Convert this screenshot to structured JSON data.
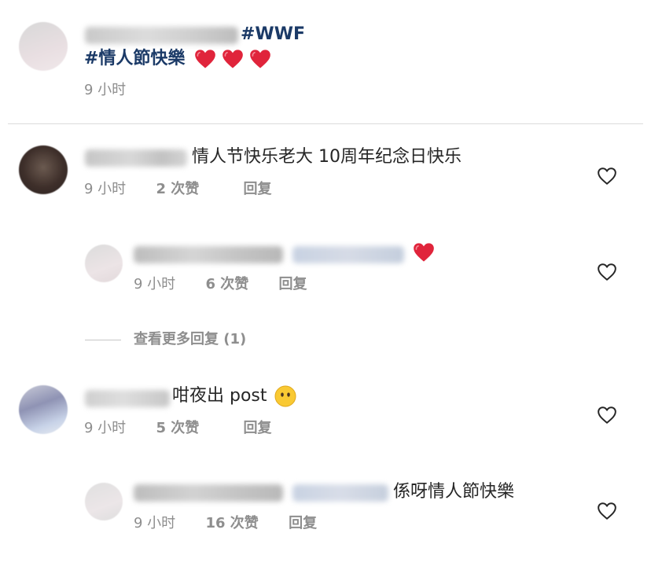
{
  "caption": {
    "hashtag_wwf": "#WWF",
    "hashtag_valentine": "#情人節快樂",
    "time": "9 小时"
  },
  "comments": [
    {
      "text": "情人节快乐老大 10周年纪念日快乐",
      "time": "9 小时",
      "likes": "2 次赞",
      "reply": "回复",
      "replies": [
        {
          "time": "9 小时",
          "likes": "6 次赞",
          "reply": "回复"
        }
      ],
      "view_more": "查看更多回复 (1)"
    },
    {
      "text": "咁夜出 post",
      "time": "9 小时",
      "likes": "5 次赞",
      "reply": "回复",
      "replies": [
        {
          "text": "係呀情人節快樂",
          "time": "9 小时",
          "likes": "16 次赞",
          "reply": "回复"
        }
      ]
    }
  ],
  "colors": {
    "hashtag": "#1b3a67",
    "meta": "#8e8e8e",
    "heart": "#e0243b",
    "divider": "#dbdbdb"
  },
  "icons": [
    "heart-emoji-icon",
    "neutral-face-emoji-icon",
    "heart-outline-icon"
  ]
}
